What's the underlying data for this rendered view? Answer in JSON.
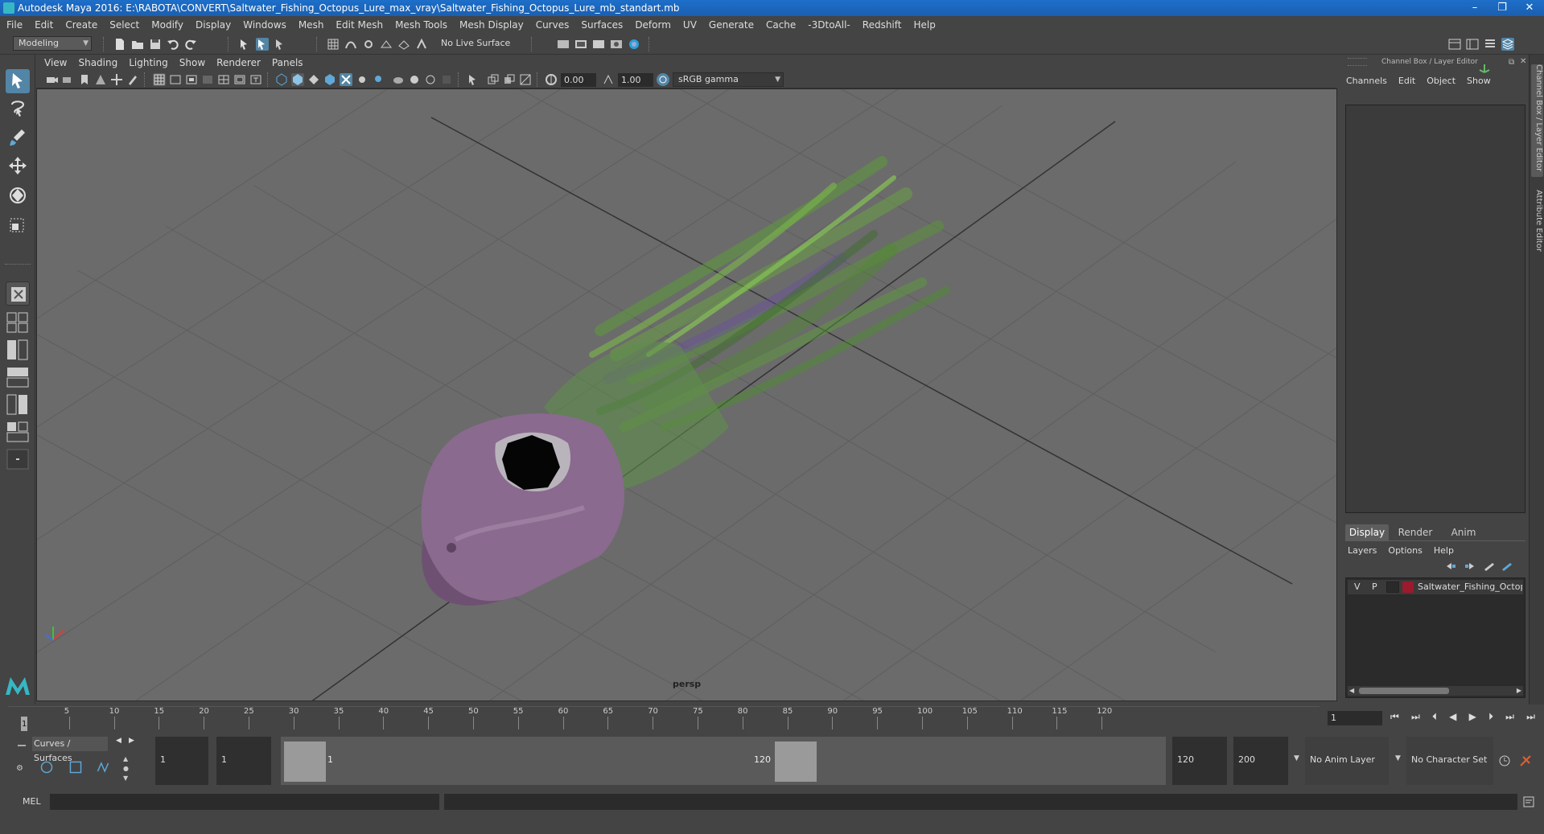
{
  "window": {
    "title": "Autodesk Maya 2016: E:\\RABOTA\\CONVERT\\Saltwater_Fishing_Octopus_Lure_max_vray\\Saltwater_Fishing_Octopus_Lure_mb_standart.mb",
    "minimize": "–",
    "restore": "❐",
    "close": "✕"
  },
  "menubar": [
    "File",
    "Edit",
    "Create",
    "Select",
    "Modify",
    "Display",
    "Windows",
    "Mesh",
    "Edit Mesh",
    "Mesh Tools",
    "Mesh Display",
    "Curves",
    "Surfaces",
    "Deform",
    "UV",
    "Generate",
    "Cache",
    "-3DtoAll-",
    "Redshift",
    "Help"
  ],
  "statusline": {
    "mode": "Modeling",
    "live_surface": "No Live Surface"
  },
  "viewport_menu": [
    "View",
    "Shading",
    "Lighting",
    "Show",
    "Renderer",
    "Panels"
  ],
  "viewport_toolbar": {
    "exposure": "0.00",
    "gamma": "1.00",
    "colorspace": "sRGB gamma"
  },
  "viewport": {
    "camera_label": "persp",
    "colors": {
      "background": "#6b6b6b",
      "grid": "#5c5c5c",
      "head": "#8a6a8e",
      "tentacles": "#5d9a3a"
    }
  },
  "channel_box": {
    "header": "Channel Box / Layer Editor",
    "menu": [
      "Channels",
      "Edit",
      "Object",
      "Show"
    ]
  },
  "layer_editor": {
    "tabs": [
      "Display",
      "Render",
      "Anim"
    ],
    "active_tab": "Display",
    "menu": [
      "Layers",
      "Options",
      "Help"
    ],
    "layer": {
      "v": "V",
      "p": "P",
      "name": "Saltwater_Fishing_Octop",
      "color": "#9b1a2c"
    }
  },
  "side_tabs": [
    "Channel Box / Layer Editor",
    "Attribute Editor"
  ],
  "timeline": {
    "ticks": [
      "5",
      "10",
      "15",
      "20",
      "25",
      "30",
      "35",
      "40",
      "45",
      "50",
      "55",
      "60",
      "65",
      "70",
      "75",
      "80",
      "85",
      "90",
      "95",
      "100",
      "105",
      "110",
      "115",
      "120"
    ],
    "start_label": "1",
    "current_frame": "1"
  },
  "range": {
    "shelf_tab": "Curves / Surfaces",
    "start_frame": "1",
    "playback_start": "1",
    "range_start_label": "1",
    "range_end_label": "120",
    "playback_end": "120",
    "end_frame": "200",
    "anim_layer": "No Anim Layer",
    "character_set": "No Character Set"
  },
  "cmdline": {
    "label": "MEL"
  }
}
